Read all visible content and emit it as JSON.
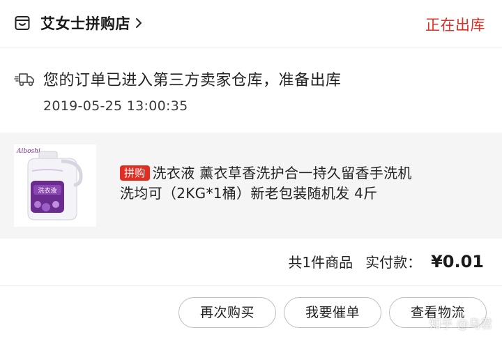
{
  "header": {
    "store_name": "艾女士拼购店",
    "status": "正在出库"
  },
  "logistics": {
    "message": "您的订单已进入第三方卖家仓库，准备出库",
    "time": "2019-05-25 13:00:35"
  },
  "product": {
    "tag": "拼购",
    "title_line1": "洗衣液 薰衣草香洗护合一持久留香手洗机",
    "title_line2": "洗均可（2KG*1桶）新老包装随机发 4斤",
    "thumb_brand": "Aiboshi",
    "thumb_label": "洗衣液"
  },
  "summary": {
    "item_count": "共1件商品",
    "paid_label": "实付款：",
    "paid_amount": "¥0.01"
  },
  "actions": {
    "rebuy": "再次购买",
    "urge": "我要催单",
    "track": "查看物流"
  },
  "watermark": "知乎 @乌君",
  "colors": {
    "accent": "#e02e24",
    "product_bg": "#f5f5f5",
    "divider": "#ececec"
  }
}
